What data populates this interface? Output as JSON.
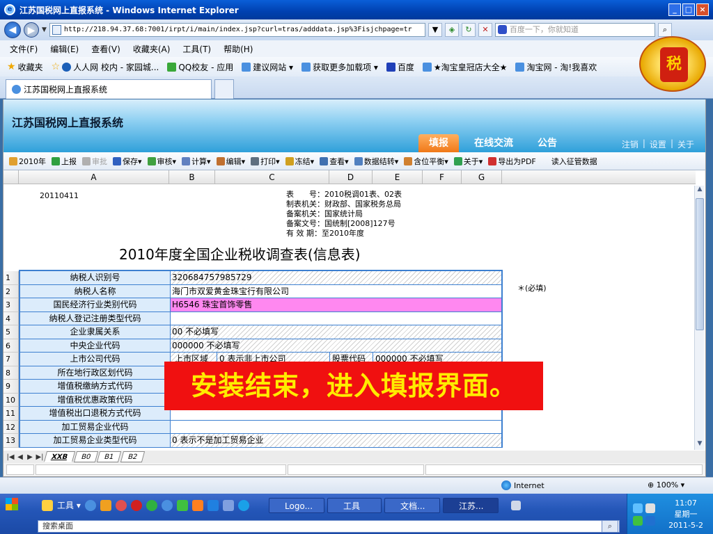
{
  "window": {
    "title": "江苏国税网上直报系统 - Windows Internet Explorer",
    "controls": [
      "_",
      "□",
      "×"
    ]
  },
  "address": {
    "url": "http://218.94.37.68:7001/irpt/i/main/index.jsp?curl=tras/adddata.jsp%3Fisjchpage=tr",
    "search_placeholder": "百度一下，你就知道"
  },
  "menu": [
    "文件(F)",
    "编辑(E)",
    "查看(V)",
    "收藏夹(A)",
    "工具(T)",
    "帮助(H)"
  ],
  "favorites": {
    "label": "收藏夹",
    "items": [
      "人人网 校内 - 家园城...",
      "QQ校友 - 应用",
      "建议网站 ▾",
      "获取更多加载项 ▾",
      "百度",
      "★淘宝皇冠店大全★",
      "淘宝网 - 淘!我喜欢"
    ]
  },
  "browser_tab": {
    "label": "江苏国税网上直报系统"
  },
  "app": {
    "title": "江苏国税网上直报系统",
    "nav": [
      "填报",
      "在线交流",
      "公告"
    ],
    "links": [
      "注销",
      "设置",
      "关于"
    ]
  },
  "toolbar": [
    {
      "label": "2010年",
      "color": "#e0a030"
    },
    {
      "label": "上报",
      "color": "#30a040"
    },
    {
      "label": "审批",
      "color": "#b0b0b0",
      "disabled": true
    },
    {
      "label": "保存▾",
      "color": "#3060c0"
    },
    {
      "label": "审核▾",
      "color": "#40a040"
    },
    {
      "label": "计算▾",
      "color": "#6080c0"
    },
    {
      "label": "编辑▾",
      "color": "#c07030"
    },
    {
      "label": "打印▾",
      "color": "#607080"
    },
    {
      "label": "冻结▾",
      "color": "#d0a020"
    },
    {
      "label": "查看▾",
      "color": "#4070b0"
    },
    {
      "label": "数据结转▾",
      "color": "#5080c0"
    },
    {
      "label": "含位平衡▾",
      "color": "#d08030"
    },
    {
      "label": "关于▾",
      "color": "#30a050"
    },
    {
      "label": "导出为PDF",
      "color": "#d03030"
    },
    {
      "label": "读入征管数据",
      "color": ""
    }
  ],
  "sheet": {
    "columns": [
      "A",
      "B",
      "C",
      "D",
      "E",
      "F",
      "G"
    ],
    "date": "20110411",
    "meta": [
      "表　　号：2010税调01表、02表",
      "制表机关：财政部、国家税务总局",
      "备案机关：国家统计局",
      "备案文号：国统制[2008]127号",
      "有 效 期：至2010年度"
    ],
    "form_title": "2010年度全国企业税收调查表(信息表)",
    "required_note": "＊(必填)",
    "rows": [
      {
        "n": "1",
        "label": "纳税人识别号",
        "value": "320684757985729"
      },
      {
        "n": "2",
        "label": "纳税人名称",
        "value": "海门市双爱黄金珠宝行有限公司"
      },
      {
        "n": "3",
        "label": "国民经济行业类别代码",
        "value": "H6546 珠宝首饰零售"
      },
      {
        "n": "4",
        "label": "纳税人登记注册类型代码",
        "value": ""
      },
      {
        "n": "5",
        "label": "企业隶属关系",
        "value": "00 不必填写"
      },
      {
        "n": "6",
        "label": "中央企业代码",
        "value": "000000 不必填写"
      },
      {
        "n": "7",
        "label": "上市公司代码",
        "value": "上市区域",
        "sub1": "0 表示非上市公司",
        "sub2": "股票代码",
        "sub3": "000000 不必填写"
      },
      {
        "n": "8",
        "label": "所在地行政区划代码",
        "value": ""
      },
      {
        "n": "9",
        "label": "增值税缴纳方式代码",
        "value": ""
      },
      {
        "n": "10",
        "label": "增值税优惠政策代码",
        "value": ""
      },
      {
        "n": "11",
        "label": "增值税出口退税方式代码",
        "value": ""
      },
      {
        "n": "12",
        "label": "加工贸易企业代码",
        "value": ""
      },
      {
        "n": "13",
        "label": "加工贸易企业类型代码",
        "value": "0 表示不是加工贸易企业"
      }
    ],
    "tabs": [
      "XXB",
      "B0",
      "B1",
      "B2"
    ]
  },
  "overlay": "安装结束，进入填报界面。",
  "status": {
    "zone": "Internet",
    "zoom": "100%"
  },
  "taskbar": {
    "tools_label": "工具 ▾",
    "tasks": [
      "Logo...",
      "工具",
      "文档...",
      "江苏..."
    ],
    "desktop_search": "搜索桌面",
    "time": "11:07",
    "weekday": "星期一",
    "date": "2011-5-2"
  },
  "emblem_text": "税"
}
